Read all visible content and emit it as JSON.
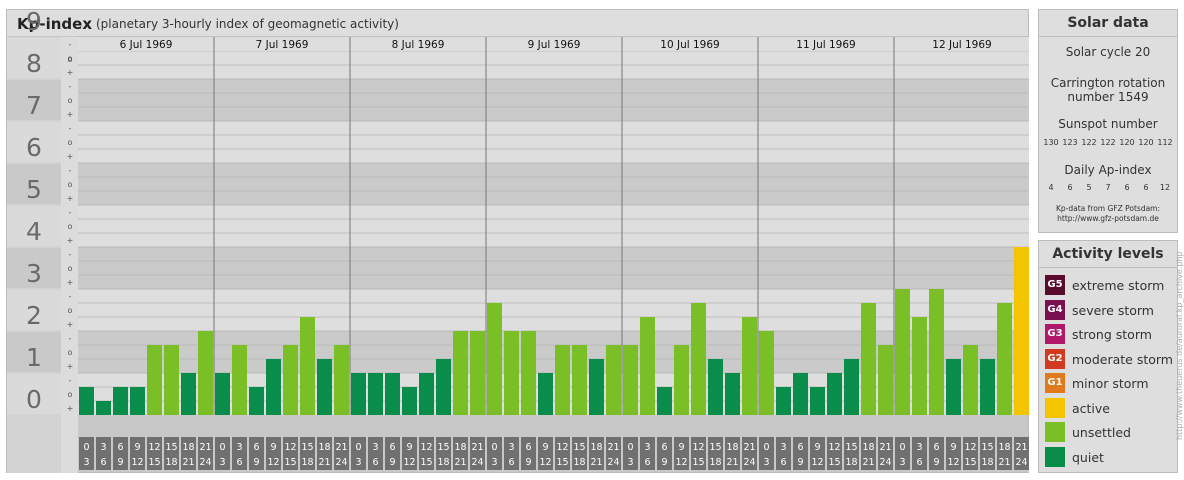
{
  "header": {
    "title": "Kp-index",
    "subtitle": "(planetary 3-hourly index of geomagnetic activity)"
  },
  "solar": {
    "title": "Solar data",
    "cycle": "Solar cycle 20",
    "carrington_1": "Carrington rotation",
    "carrington_2": "number 1549",
    "sunspot_label": "Sunspot number",
    "sunspot_values": [
      "130",
      "123",
      "122",
      "122",
      "120",
      "120",
      "112"
    ],
    "ap_label": "Daily Ap-index",
    "ap_values": [
      "4",
      "6",
      "5",
      "7",
      "6",
      "6",
      "12"
    ],
    "source_1": "Kp-data from GFZ Potsdam:",
    "source_2": "http://www.gfz-potsdam.de"
  },
  "activity": {
    "title": "Activity levels",
    "items": [
      {
        "badge": "G5",
        "label": "extreme storm",
        "color": "#5a0a2c"
      },
      {
        "badge": "G4",
        "label": "severe storm",
        "color": "#7a1050"
      },
      {
        "badge": "G3",
        "label": "strong storm",
        "color": "#b0186a"
      },
      {
        "badge": "G2",
        "label": "moderate storm",
        "color": "#d23a20"
      },
      {
        "badge": "G1",
        "label": "minor storm",
        "color": "#e07a1c"
      },
      {
        "badge": "",
        "label": "active",
        "color": "#f5c400"
      },
      {
        "badge": "",
        "label": "unsettled",
        "color": "#7bbf26"
      },
      {
        "badge": "",
        "label": "quiet",
        "color": "#0a8c4a"
      }
    ]
  },
  "watermark": "http://www.theuerus.de/auroral.kp_archive.php",
  "chart_data": {
    "type": "bar",
    "title": "Kp-index",
    "ylabel": "",
    "ylim": [
      0,
      9
    ],
    "y_ticks": [
      "0",
      "1",
      "2",
      "3",
      "4",
      "5",
      "6",
      "7",
      "8",
      "9"
    ],
    "sub_ticks": [
      "+",
      "o",
      "-"
    ],
    "days": [
      "6 Jul 1969",
      "7 Jul 1969",
      "8 Jul 1969",
      "9 Jul 1969",
      "10 Jul 1969",
      "11 Jul 1969",
      "12 Jul 1969"
    ],
    "interval_start": [
      "0",
      "3",
      "6",
      "9",
      "12",
      "15",
      "18",
      "21"
    ],
    "interval_end": [
      "3",
      "6",
      "9",
      "12",
      "15",
      "18",
      "21",
      "24"
    ],
    "values": [
      [
        0.667,
        0.333,
        0.667,
        0.667,
        1.667,
        1.667,
        1.0,
        2.0
      ],
      [
        1.0,
        1.667,
        0.667,
        1.333,
        1.667,
        2.333,
        1.333,
        1.667
      ],
      [
        1.0,
        1.0,
        1.0,
        0.667,
        1.0,
        1.333,
        2.0,
        2.0
      ],
      [
        2.667,
        2.0,
        2.0,
        1.0,
        1.667,
        1.667,
        1.333,
        1.667
      ],
      [
        1.667,
        2.333,
        0.667,
        1.667,
        2.667,
        1.333,
        1.0,
        2.333
      ],
      [
        2.0,
        0.667,
        1.0,
        0.667,
        1.0,
        1.333,
        2.667,
        1.667
      ],
      [
        3.0,
        2.333,
        3.0,
        1.333,
        1.667,
        1.333,
        2.667,
        4.0
      ]
    ],
    "colors": {
      "quiet": "#0a8c4a",
      "unsettled": "#7bbf26",
      "active": "#f5c400"
    },
    "grid": true
  }
}
